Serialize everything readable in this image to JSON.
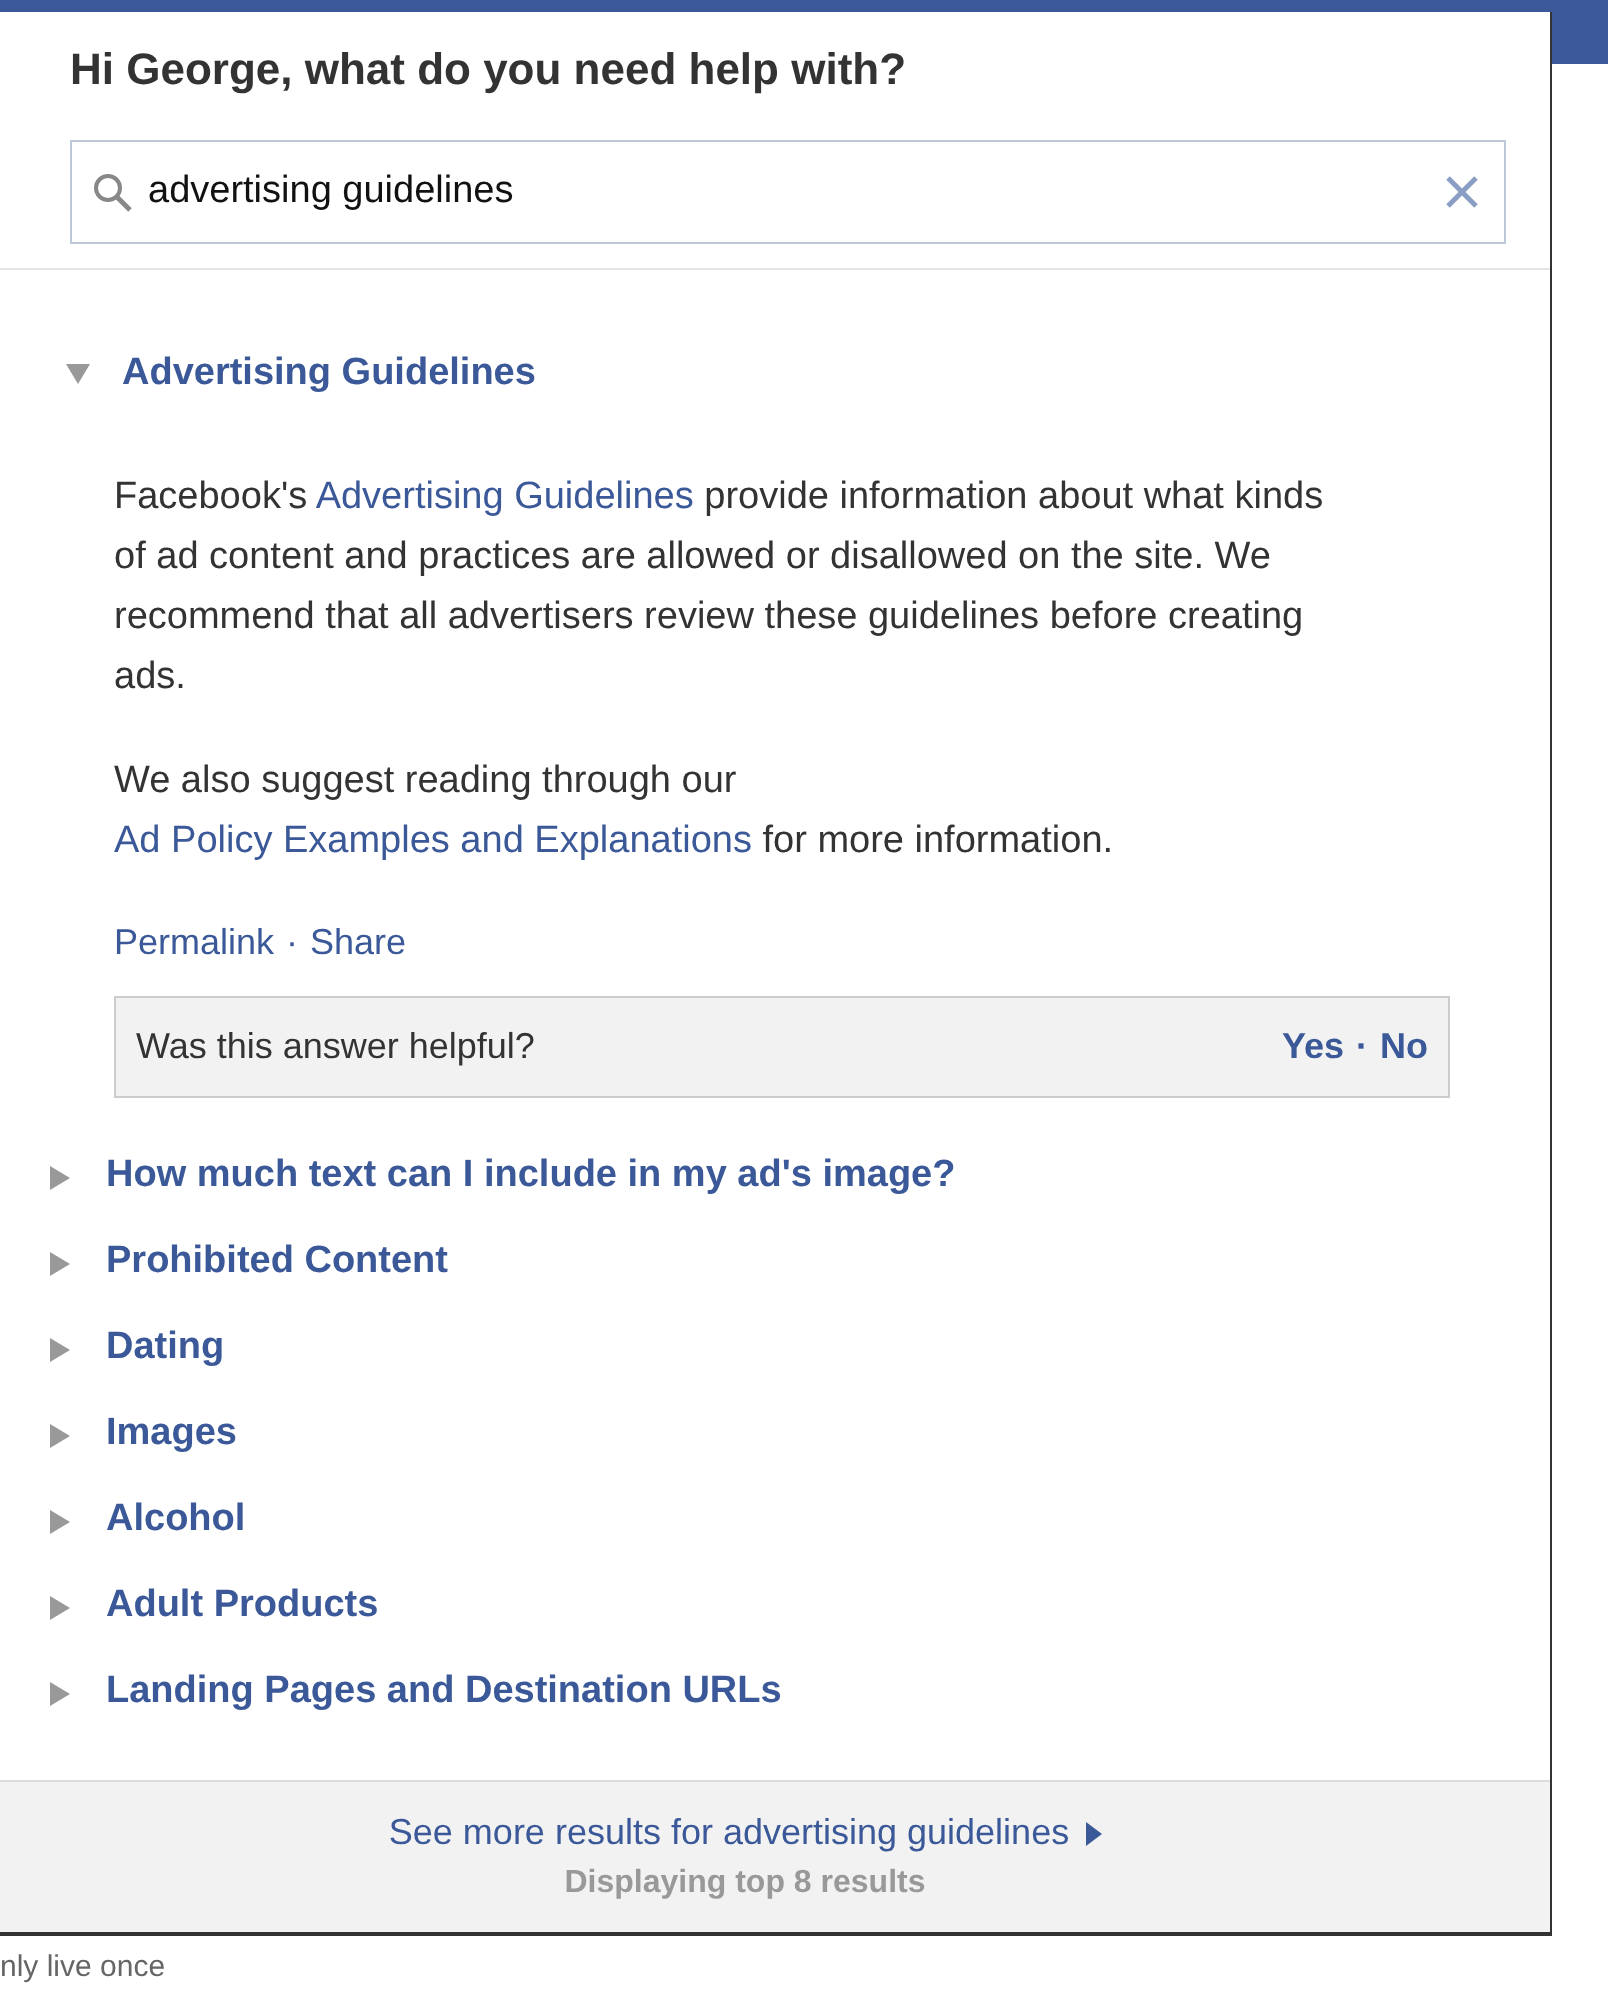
{
  "background": {
    "fragment_text": "nly live once"
  },
  "help_panel": {
    "title": "Hi George, what do you need help with?",
    "search": {
      "value": "advertising guidelines"
    },
    "results": [
      {
        "title": "Advertising Guidelines",
        "expanded": true,
        "body": [
          [
            {
              "kind": "text",
              "text": "Facebook's "
            },
            {
              "kind": "link",
              "text": "Advertising Guidelines"
            },
            {
              "kind": "text",
              "text": " provide information about what kinds of ad content and practices are allowed or disallowed on the site. We recommend that all advertisers review these guidelines before creating ads."
            }
          ],
          [
            {
              "kind": "text",
              "text": "We also suggest reading through our "
            },
            {
              "kind": "link",
              "text": "Ad Policy Examples and Explanations"
            },
            {
              "kind": "text",
              "text": " for more information."
            }
          ]
        ],
        "actions": {
          "items": [
            "Permalink",
            "Share"
          ],
          "separator": "·"
        },
        "feedback": {
          "question": "Was this answer helpful?",
          "answers": [
            "Yes",
            "No"
          ],
          "separator": "·"
        }
      },
      {
        "title": "How much text can I include in my ad's image?",
        "expanded": false
      },
      {
        "title": "Prohibited Content",
        "expanded": false
      },
      {
        "title": "Dating",
        "expanded": false
      },
      {
        "title": "Images",
        "expanded": false
      },
      {
        "title": "Alcohol",
        "expanded": false
      },
      {
        "title": "Adult Products",
        "expanded": false
      },
      {
        "title": "Landing Pages and Destination URLs",
        "expanded": false
      }
    ],
    "footer": {
      "more_link": "See more results for advertising guidelines",
      "count": "Displaying top 8 results"
    }
  }
}
